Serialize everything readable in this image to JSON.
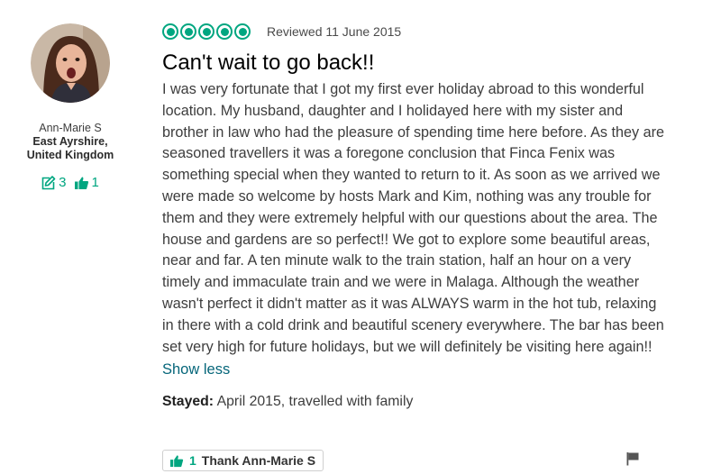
{
  "reviewer": {
    "name": "Ann-Marie S",
    "location": "East Ayrshire, United Kingdom",
    "review_count": "3",
    "helpful_votes": "1"
  },
  "review": {
    "rating": 5,
    "rating_max": 5,
    "date": "Reviewed 11 June 2015",
    "title": "Can't wait to go back!!",
    "body": "I was very fortunate that I got my first ever holiday abroad to this wonderful location. My husband, daughter and I holidayed here with my sister and brother in law who had the pleasure of spending time here before. As they are seasoned travellers it was a foregone conclusion that Finca Fenix was something special when they wanted to return to it. As soon as we arrived we were made so welcome by hosts Mark and Kim, nothing was any trouble for them and they were extremely helpful with our questions about the area. The house and gardens are so perfect!! We got to explore some beautiful areas, near and far. A ten minute walk to the train station, half an hour on a very timely and immaculate train and we were in Malaga. Although the weather wasn't perfect it didn't matter as it was ALWAYS warm in the hot tub, relaxing in there with a cold drink and beautiful scenery everywhere. The bar has been set very high for future holidays, but we will definitely be visiting here again!!",
    "show_less_label": "Show less",
    "stayed_label": "Stayed:",
    "stayed_value": "April 2015, travelled with family"
  },
  "actions": {
    "thank_count": "1",
    "thank_label": "Thank Ann-Marie S"
  },
  "icons": {
    "bubble": "rating-bubble-icon",
    "review_count": "review-count-icon",
    "thumbs_up": "thumbs-up-icon",
    "flag": "flag-icon"
  },
  "colors": {
    "accent": "#00a680",
    "link": "#06667a",
    "text": "#3d3d3d"
  }
}
